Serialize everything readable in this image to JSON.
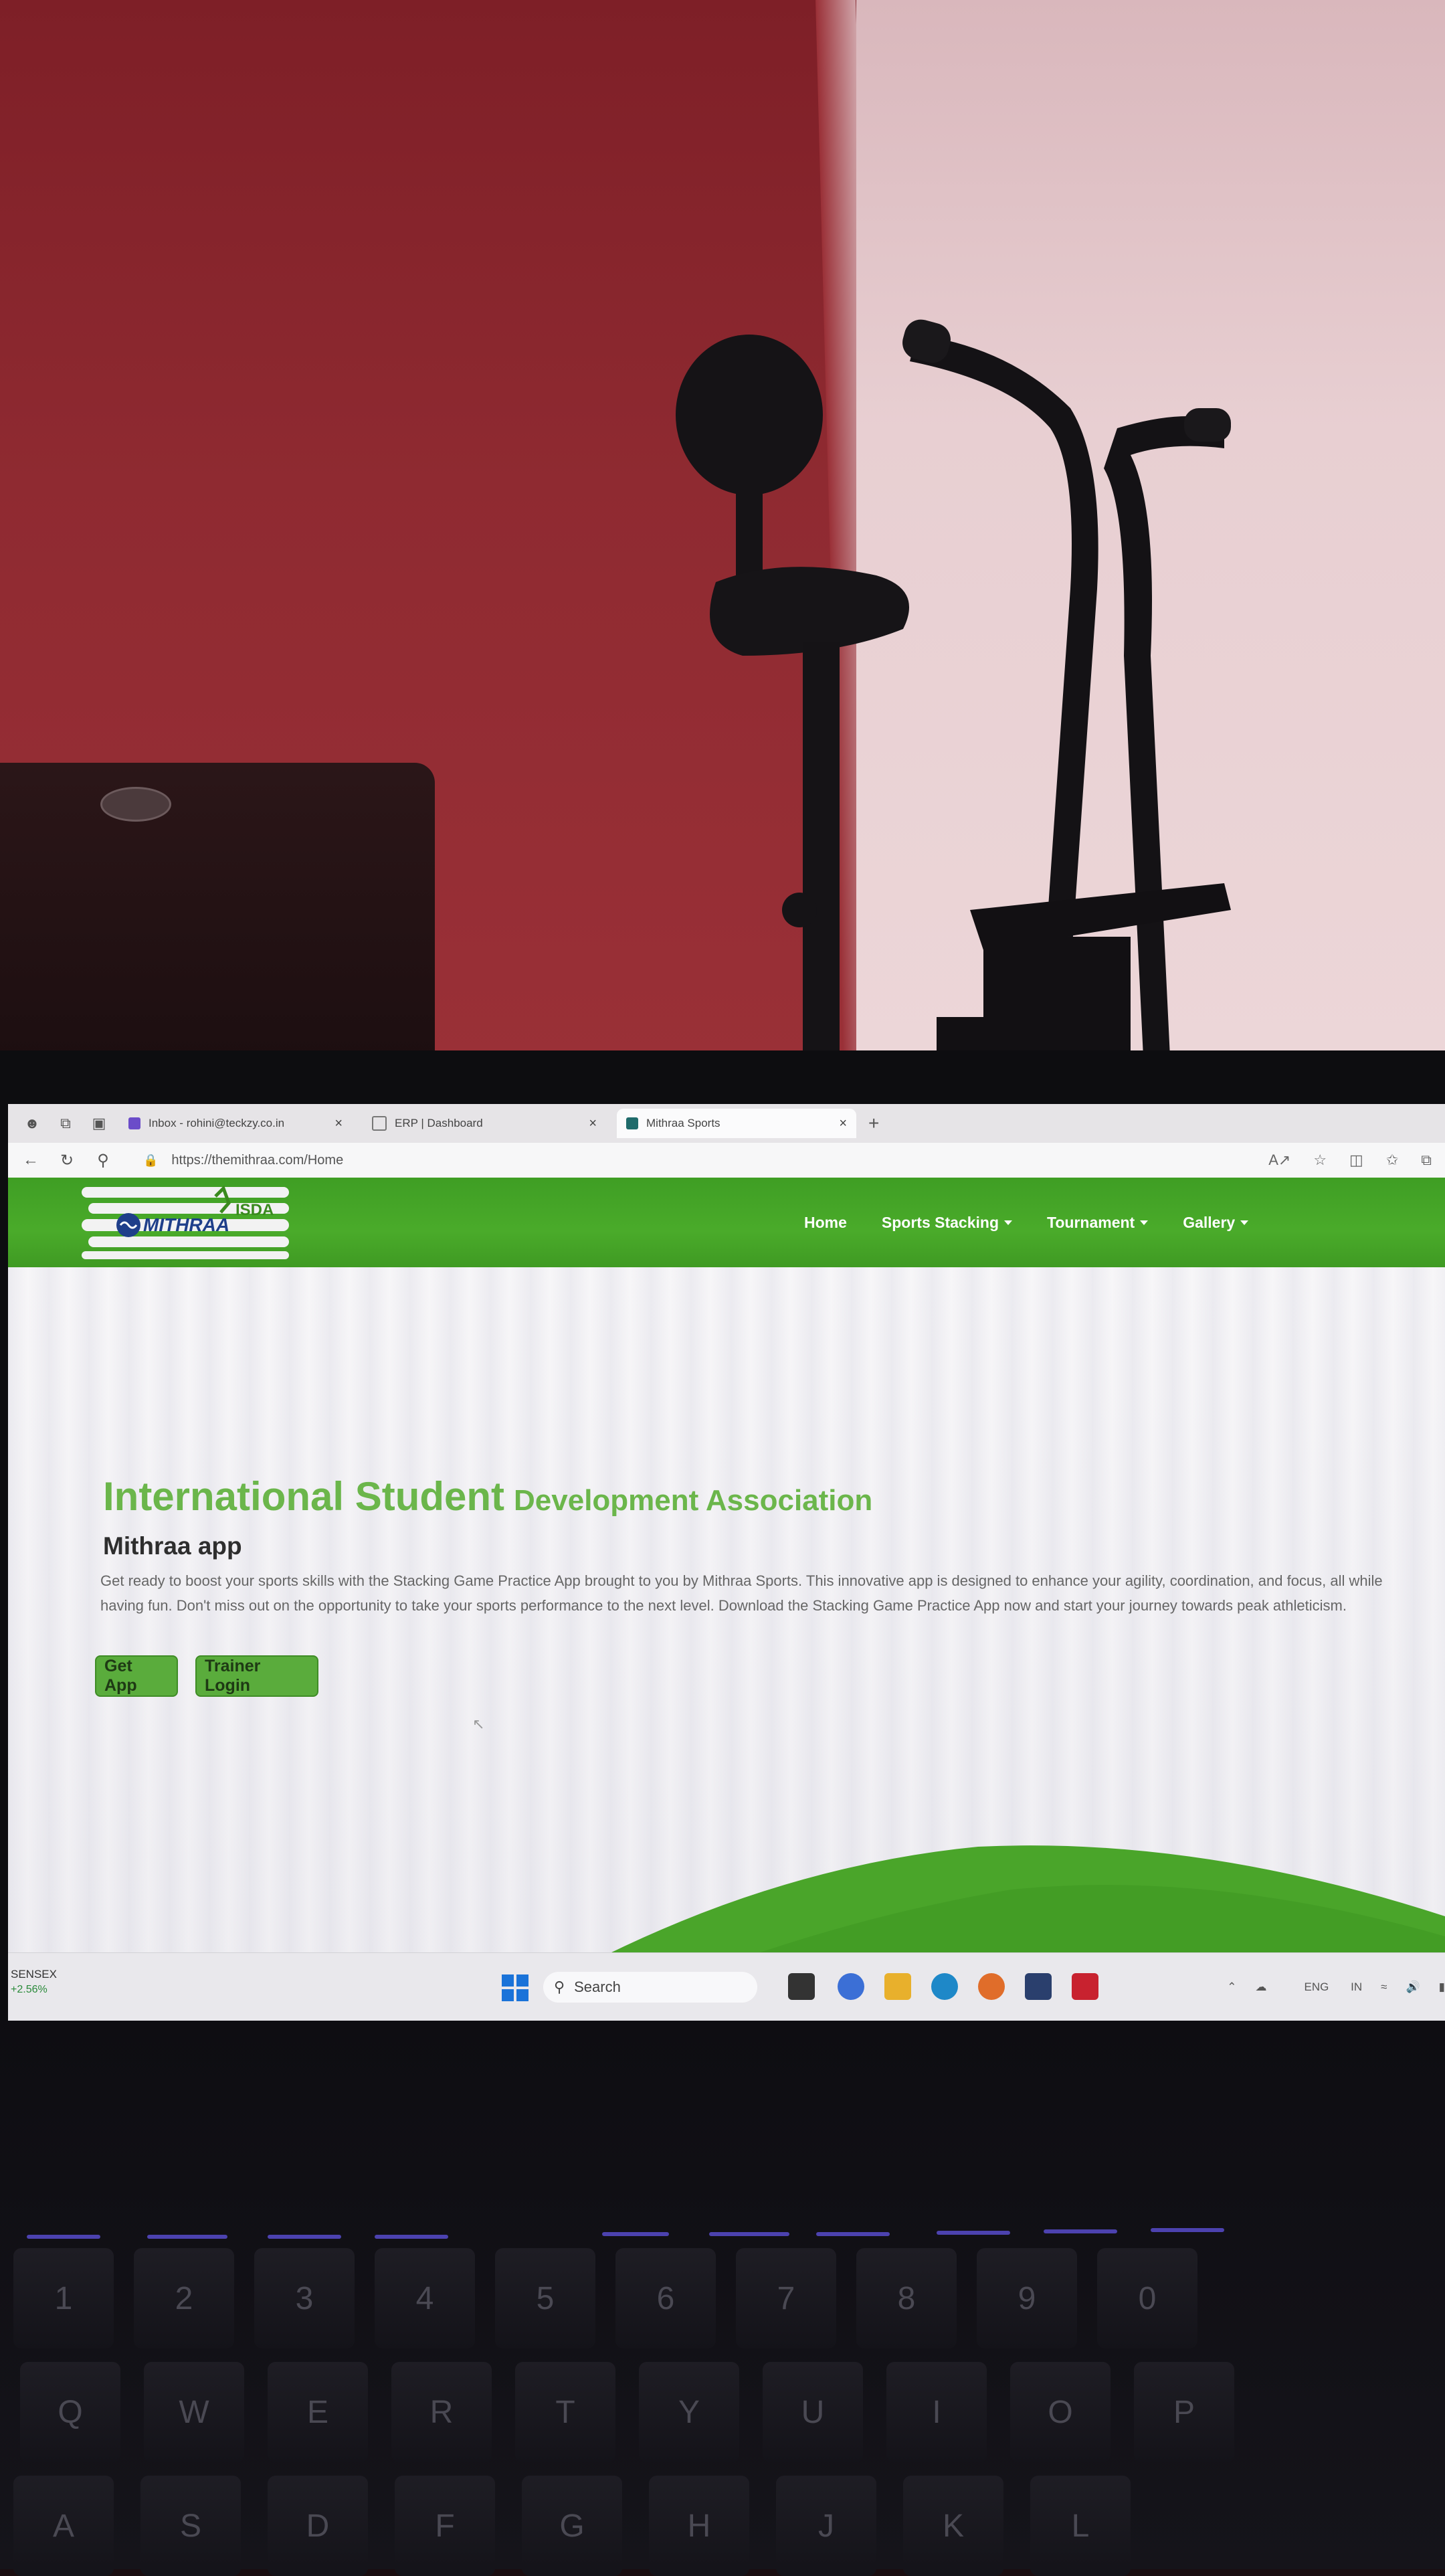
{
  "browser": {
    "tabs": [
      {
        "label": "Inbox - rohini@teckzy.co.in",
        "favicon_color": "#6b4cc9"
      },
      {
        "label": "ERP | Dashboard",
        "favicon_color": "#777777"
      },
      {
        "label": "Mithraa Sports",
        "favicon_color": "#1f6b6b",
        "active": true
      }
    ],
    "url": "https://themithraa.com/Home"
  },
  "site": {
    "logo_text": "MITHRAA",
    "logo_badge": "ISDA",
    "nav": [
      "Home",
      "Sports Stacking",
      "Tournament",
      "Gallery"
    ],
    "hero": {
      "title_big": "International Student",
      "title_small": "Development Association",
      "subtitle": "Mithraa app",
      "description": "Get ready to boost your sports skills with the Stacking Game Practice App brought to you by Mithraa Sports. This innovative app is designed to enhance your agility, coordination, and focus, all while having fun. Don't miss out on the opportunity to take your sports performance to the next level. Download the Stacking Game Practice App now and start your journey towards peak athleticism.",
      "buttons": [
        "Get App",
        "Trainer Login"
      ]
    },
    "accent_color": "#4aab2a"
  },
  "taskbar": {
    "widget_name": "SENSEX",
    "widget_change": "+2.56%",
    "search_placeholder": "Search",
    "tray_lang": "ENG",
    "tray_region": "IN"
  },
  "keyboard": {
    "row1": [
      "!",
      "@",
      "#",
      "$",
      "%",
      "^",
      "&",
      "*",
      "(",
      ")"
    ],
    "row1_digits": [
      "1",
      "2",
      "3",
      "4",
      "5",
      "6",
      "7",
      "8",
      "9",
      "0"
    ],
    "row2": [
      "Q",
      "W",
      "E",
      "R",
      "T",
      "Y",
      "U",
      "I",
      "O",
      "P"
    ],
    "row3": [
      "A",
      "S",
      "D",
      "F",
      "G",
      "H",
      "J",
      "K",
      "L"
    ]
  }
}
